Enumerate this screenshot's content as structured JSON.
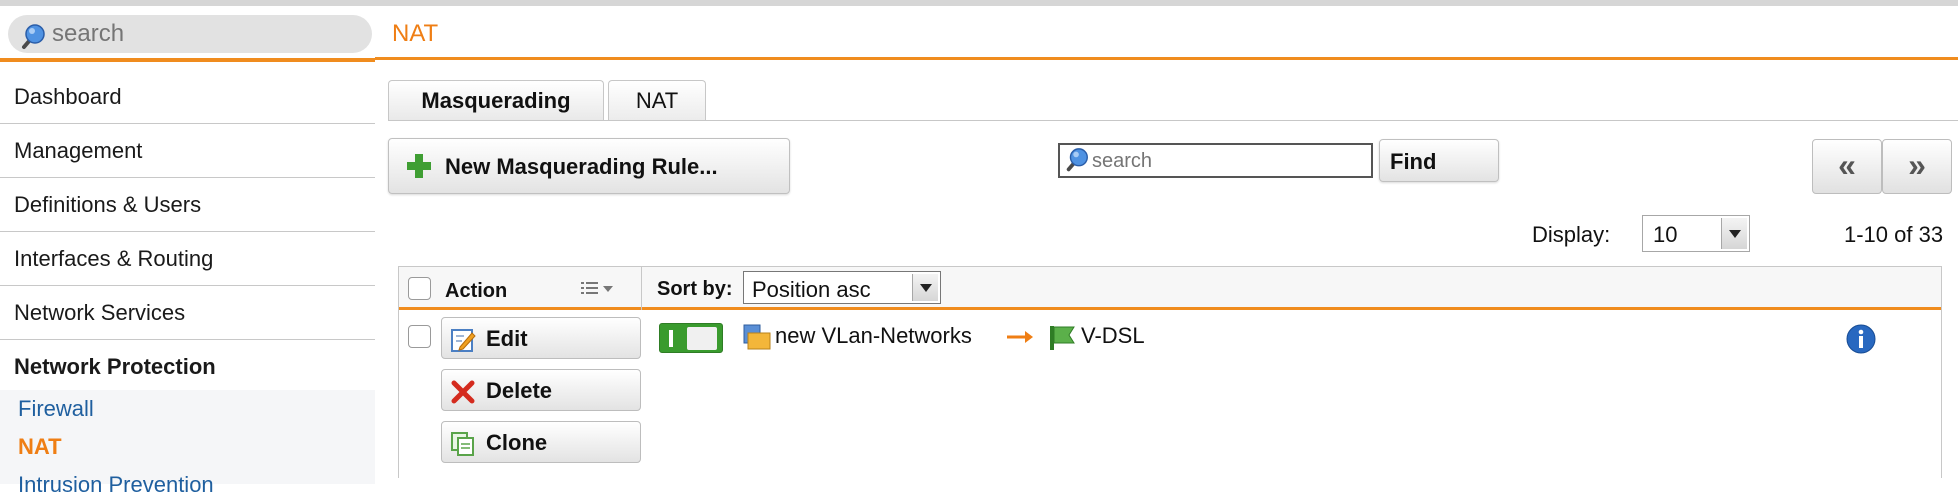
{
  "sidebar": {
    "search_placeholder": "search",
    "items": [
      {
        "label": "Dashboard"
      },
      {
        "label": "Management"
      },
      {
        "label": "Definitions & Users"
      },
      {
        "label": "Interfaces & Routing"
      },
      {
        "label": "Network Services"
      },
      {
        "label": "Network Protection"
      }
    ],
    "sub_items": [
      {
        "label": "Firewall"
      },
      {
        "label": "NAT"
      },
      {
        "label": "Intrusion Prevention"
      }
    ]
  },
  "page": {
    "title": "NAT",
    "accent_color": "#ef7e14"
  },
  "tabs": [
    {
      "label": "Masquerading",
      "active": true
    },
    {
      "label": "NAT",
      "active": false
    }
  ],
  "toolbar": {
    "new_rule_label": "New Masquerading Rule...",
    "search_placeholder": "search",
    "find_label": "Find",
    "prev_label": "«",
    "next_label": "»"
  },
  "display": {
    "label": "Display:",
    "value": "10",
    "count": "1-10 of 33"
  },
  "table": {
    "action_header": "Action",
    "sort_label": "Sort by:",
    "sort_value": "Position asc",
    "rows": [
      {
        "edit_label": "Edit",
        "delete_label": "Delete",
        "clone_label": "Clone",
        "enabled": true,
        "source": "new VLan-Networks",
        "target": "V-DSL"
      }
    ]
  }
}
